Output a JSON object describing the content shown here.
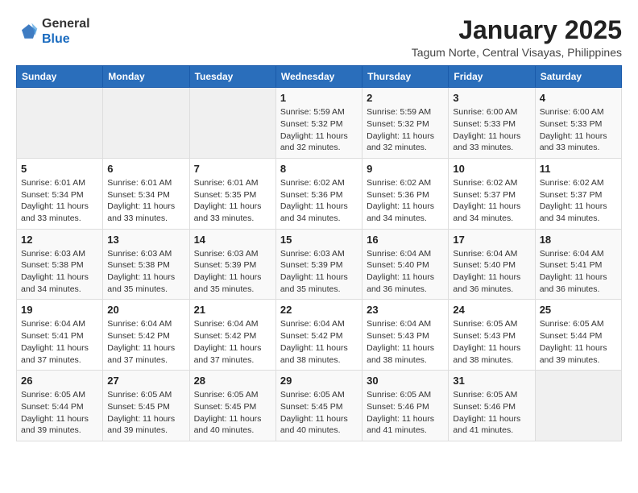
{
  "logo": {
    "general": "General",
    "blue": "Blue"
  },
  "title": "January 2025",
  "subtitle": "Tagum Norte, Central Visayas, Philippines",
  "headers": [
    "Sunday",
    "Monday",
    "Tuesday",
    "Wednesday",
    "Thursday",
    "Friday",
    "Saturday"
  ],
  "weeks": [
    [
      {
        "day": "",
        "info": ""
      },
      {
        "day": "",
        "info": ""
      },
      {
        "day": "",
        "info": ""
      },
      {
        "day": "1",
        "info": "Sunrise: 5:59 AM\nSunset: 5:32 PM\nDaylight: 11 hours\nand 32 minutes."
      },
      {
        "day": "2",
        "info": "Sunrise: 5:59 AM\nSunset: 5:32 PM\nDaylight: 11 hours\nand 32 minutes."
      },
      {
        "day": "3",
        "info": "Sunrise: 6:00 AM\nSunset: 5:33 PM\nDaylight: 11 hours\nand 33 minutes."
      },
      {
        "day": "4",
        "info": "Sunrise: 6:00 AM\nSunset: 5:33 PM\nDaylight: 11 hours\nand 33 minutes."
      }
    ],
    [
      {
        "day": "5",
        "info": "Sunrise: 6:01 AM\nSunset: 5:34 PM\nDaylight: 11 hours\nand 33 minutes."
      },
      {
        "day": "6",
        "info": "Sunrise: 6:01 AM\nSunset: 5:34 PM\nDaylight: 11 hours\nand 33 minutes."
      },
      {
        "day": "7",
        "info": "Sunrise: 6:01 AM\nSunset: 5:35 PM\nDaylight: 11 hours\nand 33 minutes."
      },
      {
        "day": "8",
        "info": "Sunrise: 6:02 AM\nSunset: 5:36 PM\nDaylight: 11 hours\nand 34 minutes."
      },
      {
        "day": "9",
        "info": "Sunrise: 6:02 AM\nSunset: 5:36 PM\nDaylight: 11 hours\nand 34 minutes."
      },
      {
        "day": "10",
        "info": "Sunrise: 6:02 AM\nSunset: 5:37 PM\nDaylight: 11 hours\nand 34 minutes."
      },
      {
        "day": "11",
        "info": "Sunrise: 6:02 AM\nSunset: 5:37 PM\nDaylight: 11 hours\nand 34 minutes."
      }
    ],
    [
      {
        "day": "12",
        "info": "Sunrise: 6:03 AM\nSunset: 5:38 PM\nDaylight: 11 hours\nand 34 minutes."
      },
      {
        "day": "13",
        "info": "Sunrise: 6:03 AM\nSunset: 5:38 PM\nDaylight: 11 hours\nand 35 minutes."
      },
      {
        "day": "14",
        "info": "Sunrise: 6:03 AM\nSunset: 5:39 PM\nDaylight: 11 hours\nand 35 minutes."
      },
      {
        "day": "15",
        "info": "Sunrise: 6:03 AM\nSunset: 5:39 PM\nDaylight: 11 hours\nand 35 minutes."
      },
      {
        "day": "16",
        "info": "Sunrise: 6:04 AM\nSunset: 5:40 PM\nDaylight: 11 hours\nand 36 minutes."
      },
      {
        "day": "17",
        "info": "Sunrise: 6:04 AM\nSunset: 5:40 PM\nDaylight: 11 hours\nand 36 minutes."
      },
      {
        "day": "18",
        "info": "Sunrise: 6:04 AM\nSunset: 5:41 PM\nDaylight: 11 hours\nand 36 minutes."
      }
    ],
    [
      {
        "day": "19",
        "info": "Sunrise: 6:04 AM\nSunset: 5:41 PM\nDaylight: 11 hours\nand 37 minutes."
      },
      {
        "day": "20",
        "info": "Sunrise: 6:04 AM\nSunset: 5:42 PM\nDaylight: 11 hours\nand 37 minutes."
      },
      {
        "day": "21",
        "info": "Sunrise: 6:04 AM\nSunset: 5:42 PM\nDaylight: 11 hours\nand 37 minutes."
      },
      {
        "day": "22",
        "info": "Sunrise: 6:04 AM\nSunset: 5:42 PM\nDaylight: 11 hours\nand 38 minutes."
      },
      {
        "day": "23",
        "info": "Sunrise: 6:04 AM\nSunset: 5:43 PM\nDaylight: 11 hours\nand 38 minutes."
      },
      {
        "day": "24",
        "info": "Sunrise: 6:05 AM\nSunset: 5:43 PM\nDaylight: 11 hours\nand 38 minutes."
      },
      {
        "day": "25",
        "info": "Sunrise: 6:05 AM\nSunset: 5:44 PM\nDaylight: 11 hours\nand 39 minutes."
      }
    ],
    [
      {
        "day": "26",
        "info": "Sunrise: 6:05 AM\nSunset: 5:44 PM\nDaylight: 11 hours\nand 39 minutes."
      },
      {
        "day": "27",
        "info": "Sunrise: 6:05 AM\nSunset: 5:45 PM\nDaylight: 11 hours\nand 39 minutes."
      },
      {
        "day": "28",
        "info": "Sunrise: 6:05 AM\nSunset: 5:45 PM\nDaylight: 11 hours\nand 40 minutes."
      },
      {
        "day": "29",
        "info": "Sunrise: 6:05 AM\nSunset: 5:45 PM\nDaylight: 11 hours\nand 40 minutes."
      },
      {
        "day": "30",
        "info": "Sunrise: 6:05 AM\nSunset: 5:46 PM\nDaylight: 11 hours\nand 41 minutes."
      },
      {
        "day": "31",
        "info": "Sunrise: 6:05 AM\nSunset: 5:46 PM\nDaylight: 11 hours\nand 41 minutes."
      },
      {
        "day": "",
        "info": ""
      }
    ]
  ]
}
